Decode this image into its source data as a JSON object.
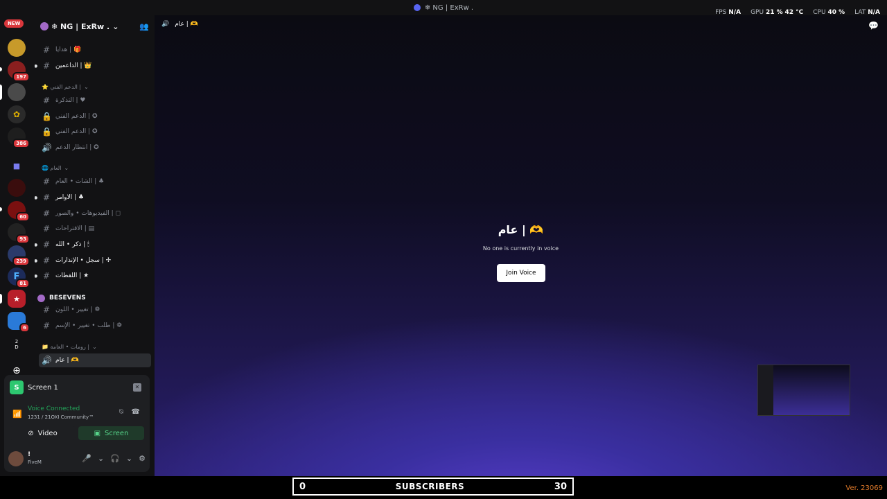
{
  "window": {
    "title": "❄ NG | ExRw ."
  },
  "perf": {
    "fps_label": "FPS",
    "fps_value": "N/A",
    "gpu_label": "GPU",
    "gpu_value": "21 %",
    "gpu_temp": "42 °C",
    "cpu_label": "CPU",
    "cpu_value": "40 %",
    "lat_label": "LAT",
    "lat_value": "N/A"
  },
  "servers": {
    "new_badge": "NEW",
    "badges": [
      "197",
      "386",
      "60",
      "93",
      "239",
      "81",
      "6"
    ],
    "folder_count_top": "2",
    "folder_letter": "D"
  },
  "guild": {
    "name": "❄ NG | ExRw ."
  },
  "channels": [
    {
      "label": "هدايا | 🎁"
    },
    {
      "label": "الداعمين | 👑"
    },
    {
      "category": "⭐ الدعم الفني |"
    },
    {
      "label": "التذكرة | ♥"
    },
    {
      "label": "الدعم الفني | ✪"
    },
    {
      "label": "الدعم الفني | ✪"
    },
    {
      "label": "انتظار الدعم | ✪"
    },
    {
      "category": "🌐 العام"
    },
    {
      "label": "الشات • العام | ♣"
    },
    {
      "label": "الاوامر | ♣"
    },
    {
      "label": "الفيديوهات • والصور | ◻"
    },
    {
      "label": "الاقتراحات | ▤"
    },
    {
      "label": "ذكر • الله | 🕯"
    },
    {
      "label": "سجل • الإنذارات | ✢"
    },
    {
      "label": "اللقطات | ★"
    },
    {
      "label": "تغيير • اللون | ❁"
    },
    {
      "label": "طلب • تغيير • الإسم | ❁"
    },
    {
      "category": "📁 رومات • العامة |"
    },
    {
      "label": "عام | 🫶"
    }
  ],
  "tooltip": {
    "text": "BESEVENS"
  },
  "panel": {
    "stream_title": "Screen 1",
    "voice_status": "Voice Connected",
    "voice_sub": "1231 / 21OXI Community™",
    "video_label": "Video",
    "screen_label": "Screen",
    "user_name": "!",
    "user_status": "FiveM"
  },
  "main": {
    "channel_name": "عام | 🫶",
    "center_title": "عام | 🫶",
    "center_sub": "No one is currently in voice",
    "join_label": "Join Voice"
  },
  "bottom": {
    "sub_start": "0",
    "sub_label": "SUBSCRIBERS",
    "sub_goal": "30",
    "version": "Ver. 23069"
  },
  "colors": {
    "accent_green": "#23a55a",
    "badge_red": "#da373c",
    "blurple": "#5865f2"
  }
}
